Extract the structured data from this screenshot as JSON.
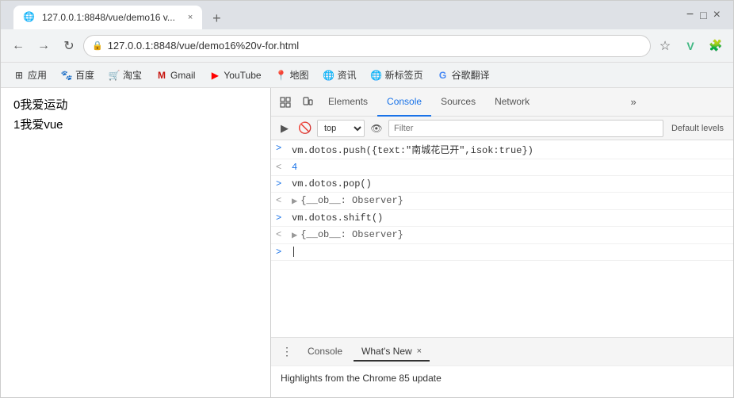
{
  "browser": {
    "title_bar": {
      "minimize": "−",
      "maximize": "□",
      "close": "×"
    },
    "tab": {
      "favicon": "🌐",
      "label": "127.0.0.1:8848/vue/demo16 v...",
      "close": "×"
    },
    "tab_new": "+",
    "nav": {
      "back": "←",
      "forward": "→",
      "refresh": "↻",
      "url_icon": "🔒",
      "url": "127.0.0.1:8848/vue/demo16%20v-for.html",
      "star": "☆",
      "vue_icon": "V",
      "extensions": "🧩"
    },
    "bookmarks": [
      {
        "icon": "⊞",
        "label": "应用"
      },
      {
        "icon": "🐾",
        "label": "百度"
      },
      {
        "icon": "🛒",
        "label": "淘宝"
      },
      {
        "icon": "M",
        "label": "Gmail"
      },
      {
        "icon": "▶",
        "label": "YouTube"
      },
      {
        "icon": "📍",
        "label": "地图"
      },
      {
        "icon": "🌐",
        "label": "资讯"
      },
      {
        "icon": "🌐",
        "label": "新标签页"
      },
      {
        "icon": "G",
        "label": "谷歌翻译"
      }
    ]
  },
  "page": {
    "lines": [
      {
        "text": "0我爱运动"
      },
      {
        "text": "1我爱vue"
      }
    ]
  },
  "devtools": {
    "tabs": [
      {
        "label": "Elements"
      },
      {
        "label": "Console",
        "active": true
      },
      {
        "label": "Sources"
      },
      {
        "label": "Network"
      },
      {
        "label": "»"
      }
    ],
    "toolbar": {
      "execute_icon": "▶",
      "clear_icon": "🚫",
      "context": "top",
      "eye_icon": "👁",
      "filter_placeholder": "Filter",
      "default_levels": "Default levels"
    },
    "console_lines": [
      {
        "prompt": ">",
        "type": "input",
        "text": "vm.dotos.push({text:\"南城花已开\",isok:true})"
      },
      {
        "prompt": "<",
        "type": "return-blue",
        "text": "4"
      },
      {
        "prompt": ">",
        "type": "input",
        "text": "vm.dotos.pop()"
      },
      {
        "prompt": "<",
        "type": "expand",
        "text": "{__ob__: Observer}"
      },
      {
        "prompt": ">",
        "type": "input",
        "text": "vm.dotos.shift()"
      },
      {
        "prompt": "<",
        "type": "expand",
        "text": "{__ob__: Observer}"
      },
      {
        "prompt": ">",
        "type": "cursor",
        "text": ""
      }
    ],
    "bottom_tabs": [
      {
        "label": "Console"
      },
      {
        "label": "What's New",
        "active": true,
        "closable": true
      }
    ],
    "bottom_menu": "⋮",
    "bottom_content": "Highlights from the Chrome 85 update"
  }
}
